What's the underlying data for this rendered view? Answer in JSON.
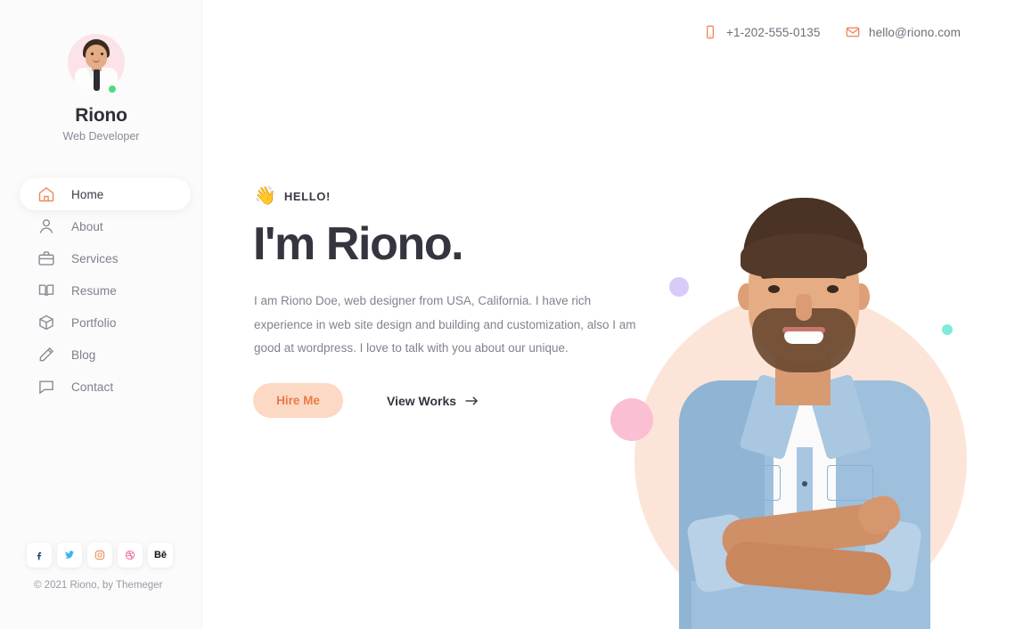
{
  "topbar": {
    "phone": {
      "icon": "phone-icon",
      "text": "+1-202-555-0135"
    },
    "email": {
      "icon": "mail-icon",
      "text": "hello@riono.com"
    }
  },
  "sidebar": {
    "profile": {
      "name": "Riono",
      "role": "Web Developer",
      "avatar_alt": "avatar",
      "status": "online"
    },
    "nav": [
      {
        "label": "Home",
        "icon": "home-icon",
        "active": true
      },
      {
        "label": "About",
        "icon": "user-icon",
        "active": false
      },
      {
        "label": "Services",
        "icon": "briefcase-icon",
        "active": false
      },
      {
        "label": "Resume",
        "icon": "book-icon",
        "active": false
      },
      {
        "label": "Portfolio",
        "icon": "box-icon",
        "active": false
      },
      {
        "label": "Blog",
        "icon": "pencil-icon",
        "active": false
      },
      {
        "label": "Contact",
        "icon": "chat-icon",
        "active": false
      }
    ],
    "socials": [
      {
        "name": "facebook",
        "glyph": "f",
        "color": "#1a3b77"
      },
      {
        "name": "twitter",
        "glyph": "t",
        "color": "#3cb4f0"
      },
      {
        "name": "instagram",
        "glyph": "i",
        "color": "#e68a52"
      },
      {
        "name": "dribbble",
        "glyph": "d",
        "color": "#ec6ea4"
      },
      {
        "name": "behance",
        "glyph": "Bē",
        "color": "#111111"
      }
    ],
    "copyright": "© 2021 Riono, by Themeger"
  },
  "hero": {
    "wave_emoji": "👋",
    "hello": "HELLO!",
    "title": "I'm Riono.",
    "description": "I am Riono Doe, web designer from USA, California. I have rich experience in web site design and building and customization, also I am good at wordpress. I love to talk with you about our unique.",
    "hire_button": "Hire Me",
    "works_link": "View Works"
  },
  "colors": {
    "accent": "#ef8a5e",
    "hire_bg": "#fcd9c5",
    "hire_text": "#e97b47",
    "heading": "#35353f",
    "body_text": "#82828f",
    "peach_circle": "#fce5d8",
    "dot_purple": "#d6ccf7",
    "dot_pink": "#fabfd2",
    "dot_teal": "#7fe9da",
    "status_green": "#4ddc7c"
  }
}
